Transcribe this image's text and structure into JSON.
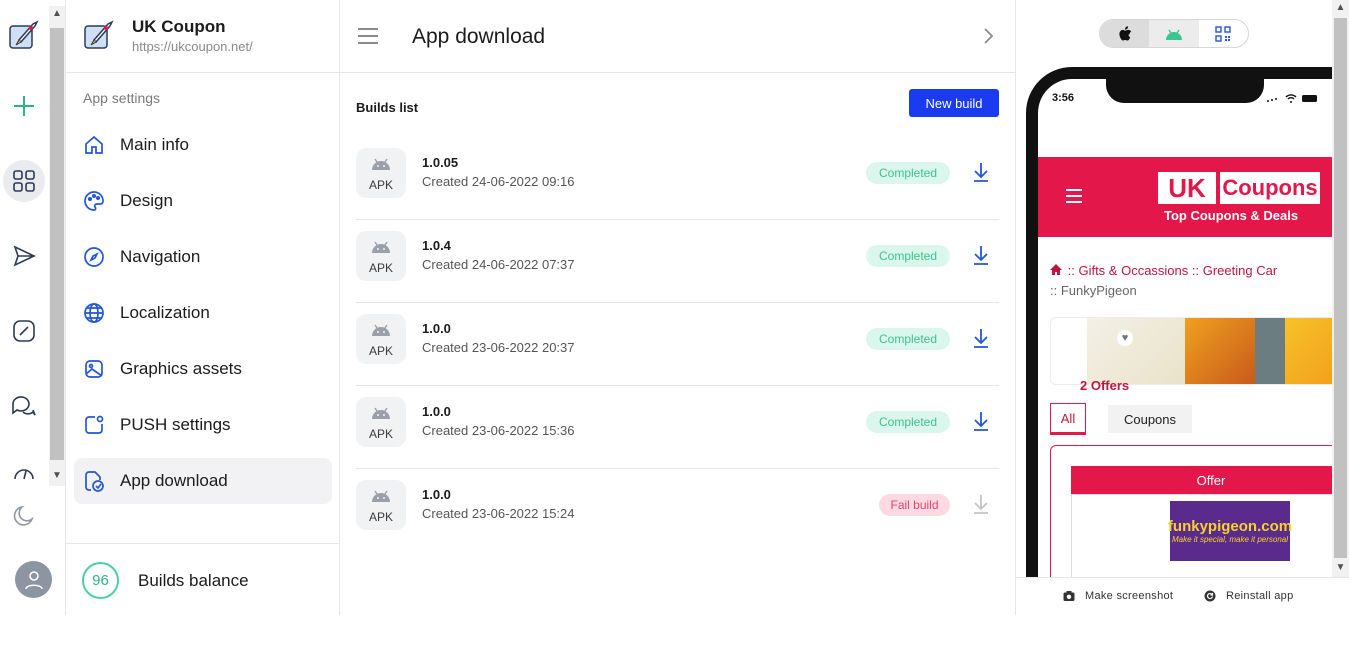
{
  "app": {
    "name": "UK Coupon",
    "url": "https://ukcoupon.net/"
  },
  "sidebar": {
    "section_title": "App settings",
    "items": [
      {
        "label": "Main info",
        "icon": "home-icon"
      },
      {
        "label": "Design",
        "icon": "palette-icon"
      },
      {
        "label": "Navigation",
        "icon": "compass-icon"
      },
      {
        "label": "Localization",
        "icon": "globe-icon"
      },
      {
        "label": "Graphics assets",
        "icon": "image-icon"
      },
      {
        "label": "PUSH settings",
        "icon": "notification-icon"
      },
      {
        "label": "App download",
        "icon": "app-download-icon",
        "active": true
      }
    ],
    "balance_value": "96",
    "balance_label": "Builds balance"
  },
  "header": {
    "title": "App download"
  },
  "builds": {
    "title": "Builds list",
    "new_build_label": "New build",
    "rows": [
      {
        "type": "APK",
        "version": "1.0.05",
        "created": "Created 24-06-2022 09:16",
        "status": "Completed"
      },
      {
        "type": "APK",
        "version": "1.0.4",
        "created": "Created 24-06-2022 07:37",
        "status": "Completed"
      },
      {
        "type": "APK",
        "version": "1.0.0",
        "created": "Created 23-06-2022 20:37",
        "status": "Completed"
      },
      {
        "type": "APK",
        "version": "1.0.0",
        "created": "Created 23-06-2022 15:36",
        "status": "Completed"
      },
      {
        "type": "APK",
        "version": "1.0.0",
        "created": "Created 23-06-2022 15:24",
        "status": "Fail build"
      }
    ]
  },
  "preview": {
    "time": "3:56",
    "logo_uk": "UK",
    "logo_coupons": "Coupons",
    "logo_tagline": "Top Coupons & Deals",
    "crumb_1": ":: Gifts & Occassions",
    "crumb_2": ":: Greeting Car",
    "crumb_3": ":: FunkyPigeon",
    "offers_count": "2 Offers",
    "filter_all": "All",
    "filter_coupons": "Coupons",
    "offer_label": "Offer",
    "offer_brand": "funkypigeon.com",
    "offer_brand_tagline": "Make it special, make it personal",
    "make_screenshot": "Make screenshot",
    "reinstall_app": "Reinstall app"
  },
  "colors": {
    "accent": "#1a3bf0",
    "nav_icon": "#2456d8",
    "success": "#3cc491",
    "fail": "#e2446f",
    "brand_red": "#e4174a"
  }
}
